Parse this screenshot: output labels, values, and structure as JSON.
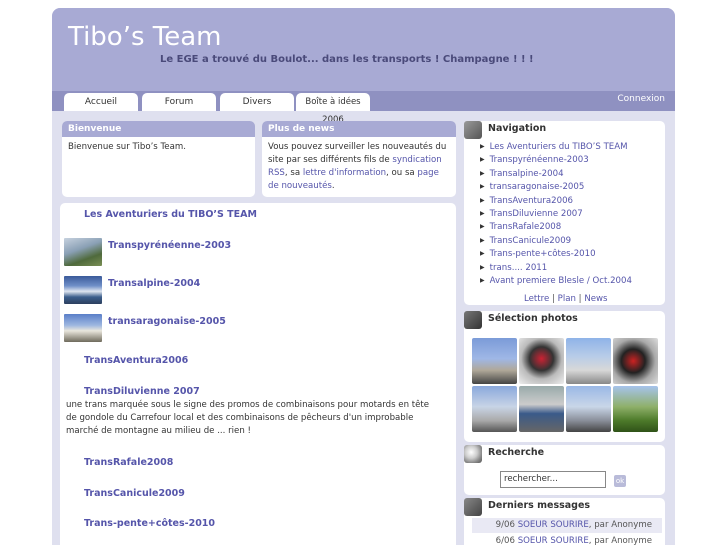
{
  "site": {
    "title": "Tibo’s Team",
    "slogan": "Le EGE a trouvé du Boulot... dans les transports ! Champagne ! ! !"
  },
  "tabs": [
    "Accueil",
    "Forum",
    "Divers",
    "Boîte à idées 2006"
  ],
  "login_label": "Connexion",
  "welcome": {
    "title": "Bienvenue",
    "text": "Bienvenue sur Tibo’s Team."
  },
  "news": {
    "title": "Plus de news",
    "text_1": "Vous pouvez surveiller les nouveautés du site par ses différents fils de ",
    "link_rss": "syndication RSS",
    "text_2": ", sa ",
    "link_letter": "lettre d'information",
    "text_3": ", ou sa ",
    "link_page": "page de nouveautés",
    "text_4": "."
  },
  "main": {
    "heading": "Les Aventuriers du TIBO’S TEAM",
    "chapters": [
      "Transpyrénéenne-2003",
      "Transalpine-2004",
      "transaragonaise-2005",
      "TransAventura2006",
      "TransDiluvienne 2007",
      "TransRafale2008",
      "TransCanicule2009",
      "Trans-pente+côtes-2010"
    ],
    "diluvienne_text": "une trans marquée sous le signe des promos de combinaisons pour motards en tête de gondole du Carrefour local et des combinaisons de pêcheurs d'un improbable marché de montagne au milieu de ... rien !"
  },
  "navigation": {
    "title": "Navigation",
    "items": [
      "Les Aventuriers du TIBO’S TEAM",
      "Transpyrénéenne-2003",
      "Transalpine-2004",
      "transaragonaise-2005",
      "TransAventura2006",
      "TransDiluvienne 2007",
      "TransRafale2008",
      "TransCanicule2009",
      "Trans-pente+côtes-2010",
      "trans.... 2011",
      "Avant premiere Blesle / Oct.2004"
    ],
    "footer_links": [
      "Lettre",
      "Plan",
      "News"
    ]
  },
  "photos": {
    "title": "Sélection photos",
    "icon": "camera-icon"
  },
  "search": {
    "title": "Recherche",
    "value": "rechercher...",
    "button": "ok",
    "icon": "magnifier-icon"
  },
  "messages": {
    "title": "Derniers messages",
    "icon": "people-icon",
    "items": [
      {
        "date": "9/06",
        "subject": "SOEUR SOURIRE",
        "by": ", par Anonyme"
      },
      {
        "date": "6/06",
        "subject": "SOEUR SOURIRE",
        "by": ", par Anonyme"
      }
    ]
  },
  "colors": {
    "header": "#a8aad4",
    "navbar": "#8f91c1",
    "page_bg": "#dfe0ef",
    "link": "#5555aa"
  }
}
